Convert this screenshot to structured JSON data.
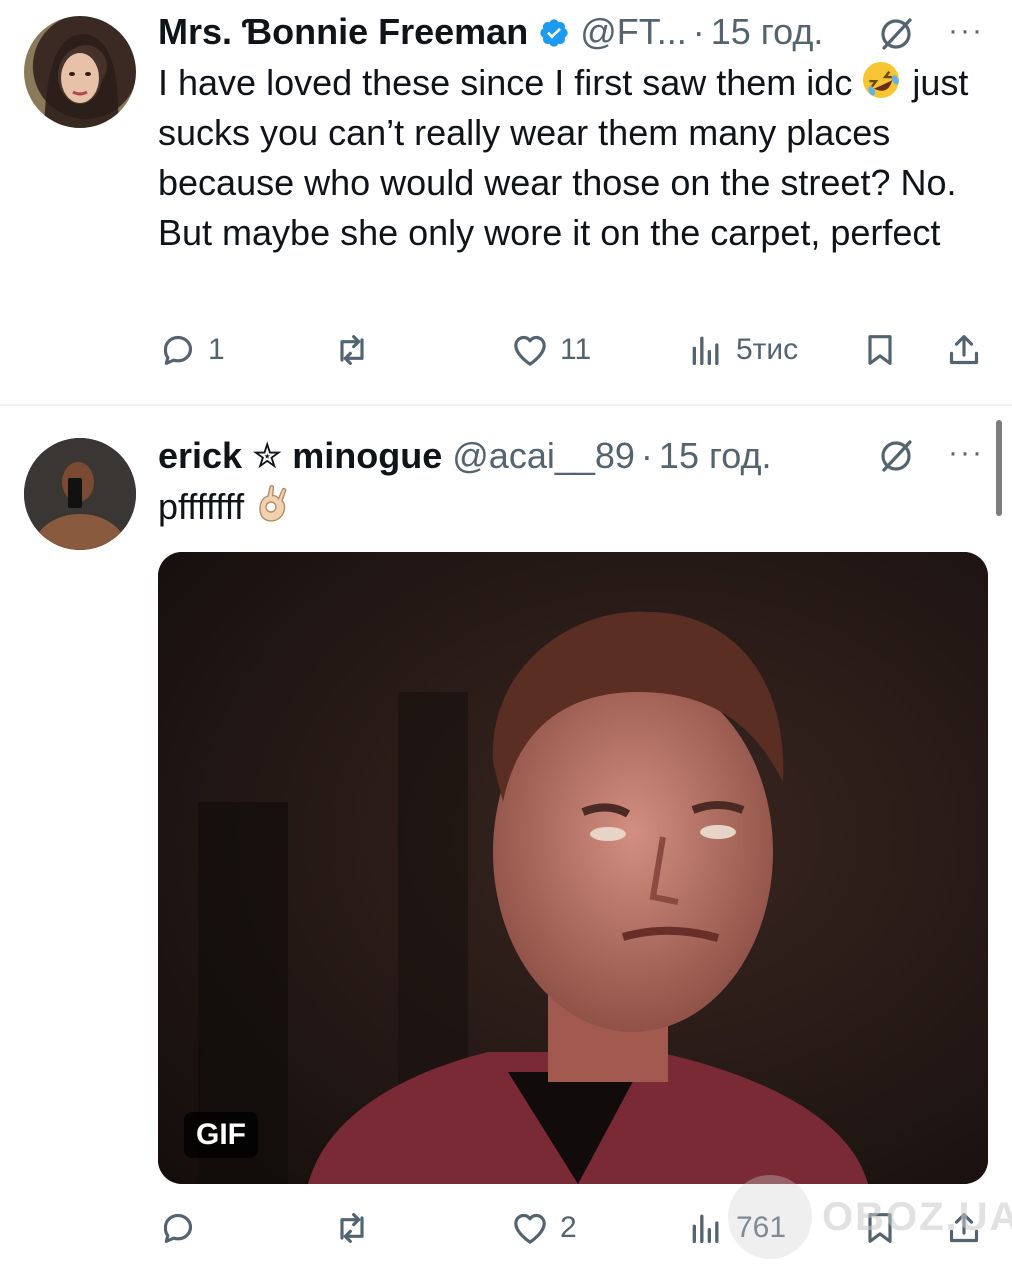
{
  "tweets": [
    {
      "author_name": "Mrs. Ɓonnie Freeman",
      "verified": true,
      "handle": "@FT...",
      "dot": "·",
      "time": "15 год.",
      "text": "I have loved these since I first saw them idc",
      "text_emoji": "rolling-on-floor-laughing",
      "text_rest": " just sucks you can’t really wear them many places because who would wear those on the street? No. But maybe she only wore it on the carpet, perfect",
      "stats": {
        "replies": "1",
        "retweets": "",
        "likes": "11",
        "views": "5тис"
      }
    },
    {
      "author_name": "erick ✮ minogue",
      "verified": false,
      "handle": "@acai__89",
      "dot": "·",
      "time": "15 год.",
      "text": "pfffffff",
      "text_emoji": "ok-hand",
      "media": {
        "type": "gif",
        "badge": "GIF"
      },
      "stats": {
        "replies": "",
        "retweets": "",
        "likes": "2",
        "views": "761"
      }
    }
  ],
  "more_label": "···",
  "watermark": "OBOZ.UA",
  "colors": {
    "verified_blue": "#1d9bf0",
    "secondary_text": "#536471",
    "primary_text": "#0f1419"
  }
}
